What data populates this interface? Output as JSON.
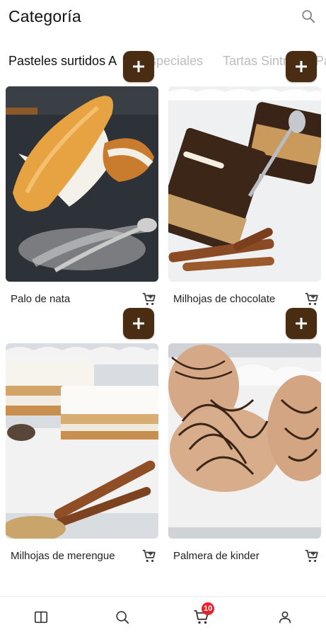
{
  "header": {
    "title": "Categoría"
  },
  "tabs": [
    {
      "label": "Pasteles surtidos A",
      "active": true
    },
    {
      "label": "Especiales",
      "active": false
    },
    {
      "label": "Tartas Sintro",
      "active": false
    },
    {
      "label": "Pa",
      "active": false
    }
  ],
  "products": [
    {
      "name": "Palo de nata",
      "add_label": "+"
    },
    {
      "name": "Milhojas de chocolate",
      "add_label": "+"
    },
    {
      "name": "Milhojas de merengue",
      "add_label": "+"
    },
    {
      "name": "Palmera de kinder",
      "add_label": "+"
    }
  ],
  "bottom_nav": {
    "items": [
      "menu-book-icon",
      "search-icon",
      "cart-icon",
      "profile-icon"
    ],
    "cart_badge": "10"
  },
  "colors": {
    "accent": "#4a2c12",
    "badge": "#e8222b",
    "inactive_tab": "#bdbdbd"
  }
}
